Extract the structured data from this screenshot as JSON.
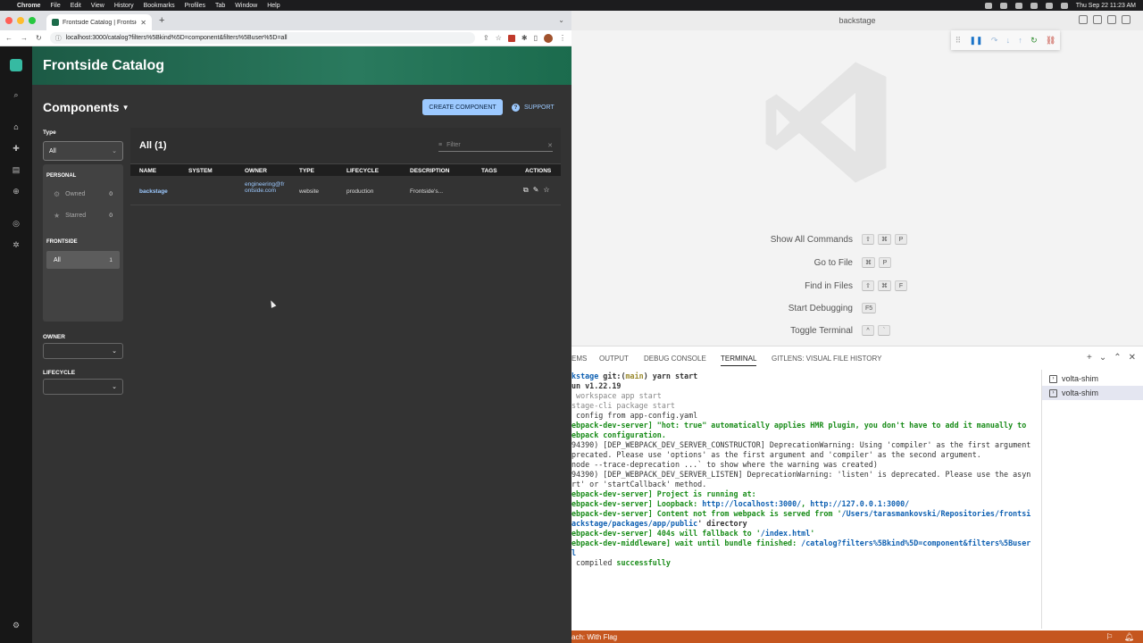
{
  "menubar": {
    "apple": "",
    "app": "Chrome",
    "items": [
      "File",
      "Edit",
      "View",
      "History",
      "Bookmarks",
      "Profiles",
      "Tab",
      "Window",
      "Help"
    ],
    "clock": "Thu Sep 22  11:23 AM"
  },
  "browser": {
    "tab_title": "Frontside Catalog | Frontside B...",
    "url": "localhost:3000/catalog?filters%5Bkind%5D=component&filters%5Buser%5D=all"
  },
  "backstage": {
    "header_title": "Frontside Catalog",
    "page_title": "Components",
    "create_button": "CREATE COMPONENT",
    "support_button": "SUPPORT",
    "filters": {
      "type_label": "Type",
      "type_value": "All",
      "personal_label": "PERSONAL",
      "owned_label": "Owned",
      "owned_count": "0",
      "starred_label": "Starred",
      "starred_count": "0",
      "org_label": "FRONTSIDE",
      "all_label": "All",
      "all_count": "1",
      "owner_label": "OWNER",
      "lifecycle_label": "LIFECYCLE"
    },
    "table": {
      "title": "All (1)",
      "filter_placeholder": "Filter",
      "columns": [
        "NAME",
        "SYSTEM",
        "OWNER",
        "TYPE",
        "LIFECYCLE",
        "DESCRIPTION",
        "TAGS",
        "ACTIONS"
      ],
      "row": {
        "name": "backstage",
        "system": "",
        "owner": "engineering@frontside.com",
        "type": "website",
        "lifecycle": "production",
        "description": "Frontside's...",
        "tags": ""
      }
    }
  },
  "vscode": {
    "window_title": "backstage",
    "shortcuts": [
      {
        "label": "Show All Commands",
        "keys": [
          "⇧",
          "⌘",
          "P"
        ]
      },
      {
        "label": "Go to File",
        "keys": [
          "⌘",
          "P"
        ]
      },
      {
        "label": "Find in Files",
        "keys": [
          "⇧",
          "⌘",
          "F"
        ]
      },
      {
        "label": "Start Debugging",
        "keys": [
          "F5"
        ]
      },
      {
        "label": "Toggle Terminal",
        "keys": [
          "^",
          "`"
        ]
      }
    ],
    "panel_tabs": [
      "EMS",
      "OUTPUT",
      "DEBUG CONSOLE",
      "TERMINAL",
      "GITLENS: VISUAL FILE HISTORY"
    ],
    "terminals": [
      "volta-shim",
      "volta-shim"
    ],
    "status_left": "ach: With Flag",
    "terminal": {
      "l1a": "kstage ",
      "l1b": "git:(",
      "l1c": "main",
      "l1d": ") yarn start",
      "l2": "un v1.22.19",
      "l3": " workspace app start",
      "l4": "stage-cli package start",
      "l5": " config from app-config.yaml",
      "l6": "ebpack-dev-server] \"hot: true\" automatically applies HMR plugin, you don't have to add it manually to",
      "l7": "ebpack configuration.",
      "l8": "94390) [DEP_WEBPACK_DEV_SERVER_CONSTRUCTOR] DeprecationWarning: Using 'compiler' as the first argument",
      "l9": "precated. Please use 'options' as the first argument and 'compiler' as the second argument.",
      "l10": "node --trace-deprecation ...` to show where the warning was created)",
      "l11": "94390) [DEP_WEBPACK_DEV_SERVER_LISTEN] DeprecationWarning: 'listen' is deprecated. Please use the asyn",
      "l12": "rt' or 'startCallback' method.",
      "l13": "ebpack-dev-server] Project is running at:",
      "l14a": "ebpack-dev-server] Loopback: ",
      "l14b": "http://localhost:3000/",
      "l14c": ", ",
      "l14d": "http://127.0.0.1:3000/",
      "l15a": "ebpack-dev-server] Content not from webpack is served from '",
      "l15b": "/Users/tarasmankovski/Repositories/frontsi",
      "l16a": "ackstage/packages/app/public",
      "l16b": "' directory",
      "l17a": "ebpack-dev-server] 404s will fallback to '",
      "l17b": "/index.html",
      "l17c": "'",
      "l18a": "ebpack-dev-middleware] wait until bundle finished: ",
      "l18b": "/catalog?filters%5Bkind%5D=component&filters%5Buser",
      "l19": "l",
      "l20a": " compiled ",
      "l20b": "successfully"
    }
  }
}
